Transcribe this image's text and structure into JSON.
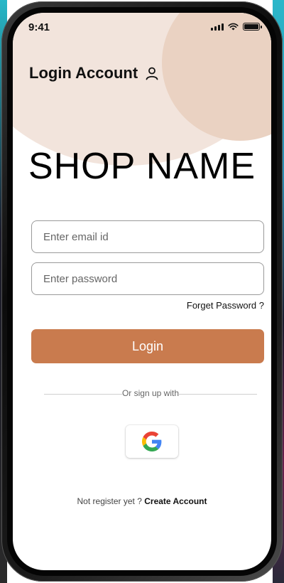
{
  "status_bar": {
    "time": "9:41"
  },
  "header": {
    "title": "Login Account"
  },
  "brand": {
    "shop_name": "SHOP NAME"
  },
  "form": {
    "email_placeholder": "Enter email id",
    "email_value": "",
    "password_placeholder": "Enter password",
    "password_value": "",
    "forgot_label": "Forget Password ?",
    "login_label": "Login"
  },
  "social": {
    "divider_text": "Or sign up with"
  },
  "register": {
    "prompt": "Not register yet ?",
    "link_label": "Create Account"
  },
  "colors": {
    "accent": "#c97b4e",
    "blob_light": "#f2e4dc",
    "blob_dark": "#ead2c2"
  },
  "icons": {
    "user": "user-icon",
    "google": "google-icon",
    "signal": "signal-icon",
    "wifi": "wifi-icon",
    "battery": "battery-icon"
  }
}
